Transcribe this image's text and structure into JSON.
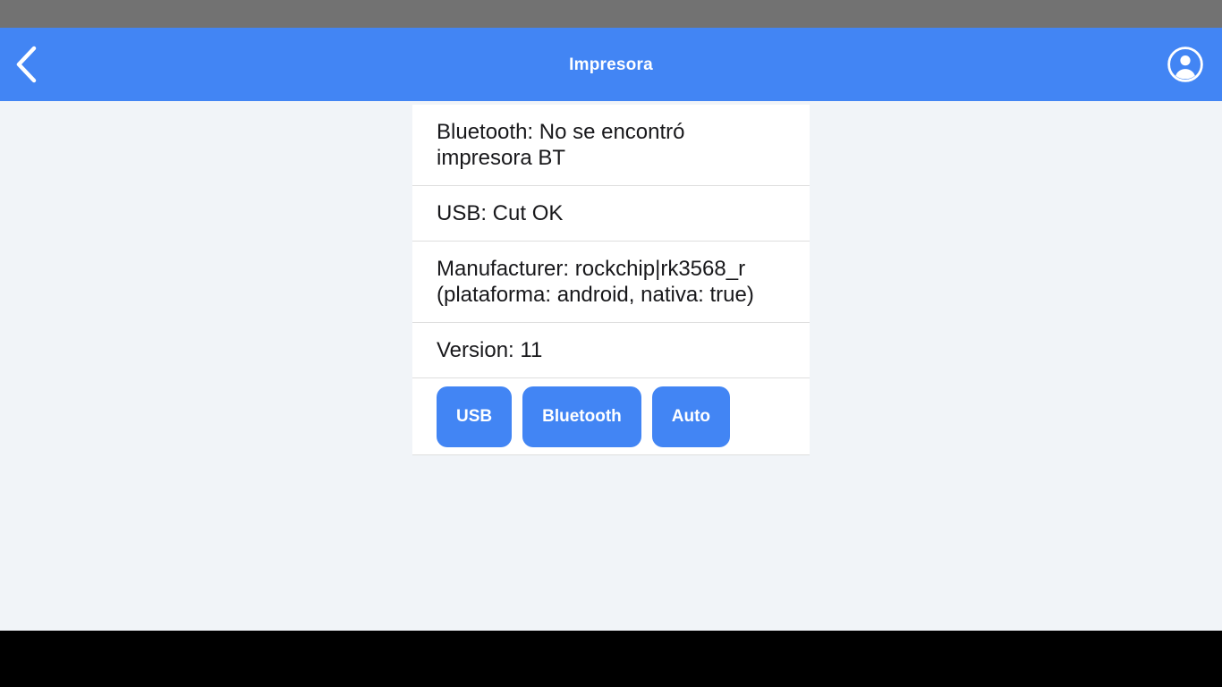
{
  "app_bar": {
    "title": "Impresora",
    "back_icon": "chevron-left-icon",
    "account_icon": "account-circle-icon",
    "background_color": "#4285F4",
    "text_color": "#FFFFFF"
  },
  "status_bar": {
    "background_color": "#727272"
  },
  "page": {
    "background_color": "#F1F4F8"
  },
  "card": {
    "background_color": "#FFFFFF",
    "divider_color": "#DEDEDE",
    "rows": [
      {
        "id": "bluetooth",
        "text": "Bluetooth: No se encontró\nimpresora BT"
      },
      {
        "id": "usb",
        "text": "USB: Cut OK"
      },
      {
        "id": "manufacturer",
        "text": "Manufacturer: rockchip|rk3568_r\n(plataforma: android, nativa: true)"
      },
      {
        "id": "version",
        "text": "Version: 11"
      }
    ],
    "buttons": [
      {
        "id": "usb",
        "label": "USB",
        "color": "#4285F4"
      },
      {
        "id": "bluetooth",
        "label": "Bluetooth",
        "color": "#4285F4"
      },
      {
        "id": "auto",
        "label": "Auto",
        "color": "#4285F4"
      }
    ]
  },
  "nav_bar": {
    "background_color": "#000000"
  }
}
